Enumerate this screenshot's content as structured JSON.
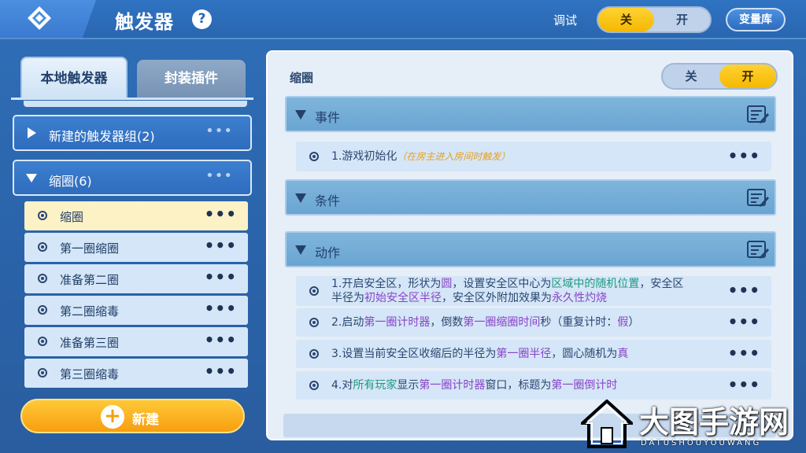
{
  "header": {
    "title": "触发器",
    "help_icon": "?",
    "debug_label": "调试",
    "debug_off": "关",
    "debug_on": "开",
    "variable_library": "变量库"
  },
  "sidebar": {
    "tabs": [
      "本地触发器",
      "封装插件"
    ],
    "groups": [
      {
        "label": "新建的触发器组(2)",
        "expanded": false
      },
      {
        "label": "缩圈(6)",
        "expanded": true
      }
    ],
    "items": [
      {
        "label": "缩圈",
        "selected": true
      },
      {
        "label": "第一圈缩圈",
        "selected": false
      },
      {
        "label": "准备第二圈",
        "selected": false
      },
      {
        "label": "第二圈缩毒",
        "selected": false
      },
      {
        "label": "准备第三圈",
        "selected": false
      },
      {
        "label": "第三圈缩毒",
        "selected": false
      }
    ],
    "more": "•••",
    "new_button": "新建"
  },
  "trigger": {
    "name": "缩圈",
    "toggle_off": "关",
    "toggle_on": "开",
    "enabled": true,
    "sections": {
      "event": "事件",
      "condition": "条件",
      "action": "动作"
    },
    "event_entry": {
      "text": "1.游戏初始化",
      "hint": "（在房主进入房间时触发）"
    },
    "actions": [
      {
        "a1": "1.开启安全区，形状为",
        "a2": "圆",
        "a3": "，设置安全区中心为",
        "a4": "区域中的随机位置",
        "a5": "，安全区",
        "b1": "半径为",
        "b2": "初始安全区半径",
        "b3": "，安全区外附加效果为",
        "b4": "永久性灼烧"
      },
      {
        "a1": "2.启动",
        "a2": "第一圈计时器",
        "a3": "，倒数",
        "a4": "第一圈缩圈时间",
        "a5": "秒（重复计时：",
        "a6": "假",
        "a7": "）"
      },
      {
        "a1": "3.设置当前安全区收缩后的半径为",
        "a2": "第一圈半径",
        "a3": "，圆心随机为",
        "a4": "真"
      },
      {
        "a1": "4.对",
        "a2": "所有玩家",
        "a3": "显示",
        "a4": "第一圈计时器",
        "a5": "窗口，标题为",
        "a6": "第一圈倒计时"
      }
    ],
    "more": "•••"
  },
  "watermark": {
    "main": "大图手游网",
    "sub": "DATUSHOUYOUWANG"
  },
  "colors": {
    "accent_yellow": "#f5b800",
    "panel_blue": "#2f6cbd",
    "highlight_green": "#1f9a80",
    "highlight_purple": "#8a42c8",
    "hint_orange": "#e8a020"
  }
}
